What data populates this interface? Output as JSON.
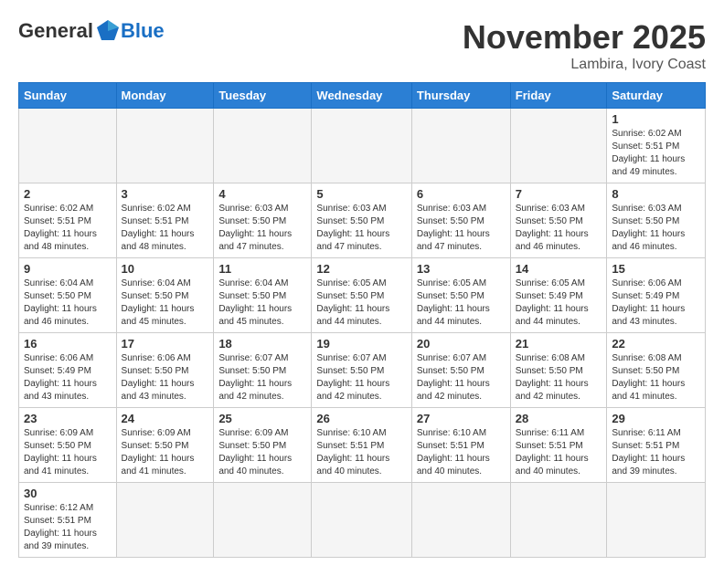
{
  "header": {
    "logo_general": "General",
    "logo_blue": "Blue",
    "month_title": "November 2025",
    "location": "Lambira, Ivory Coast"
  },
  "weekdays": [
    "Sunday",
    "Monday",
    "Tuesday",
    "Wednesday",
    "Thursday",
    "Friday",
    "Saturday"
  ],
  "weeks": [
    [
      {
        "day": "",
        "info": ""
      },
      {
        "day": "",
        "info": ""
      },
      {
        "day": "",
        "info": ""
      },
      {
        "day": "",
        "info": ""
      },
      {
        "day": "",
        "info": ""
      },
      {
        "day": "",
        "info": ""
      },
      {
        "day": "1",
        "info": "Sunrise: 6:02 AM\nSunset: 5:51 PM\nDaylight: 11 hours\nand 49 minutes."
      }
    ],
    [
      {
        "day": "2",
        "info": "Sunrise: 6:02 AM\nSunset: 5:51 PM\nDaylight: 11 hours\nand 48 minutes."
      },
      {
        "day": "3",
        "info": "Sunrise: 6:02 AM\nSunset: 5:51 PM\nDaylight: 11 hours\nand 48 minutes."
      },
      {
        "day": "4",
        "info": "Sunrise: 6:03 AM\nSunset: 5:50 PM\nDaylight: 11 hours\nand 47 minutes."
      },
      {
        "day": "5",
        "info": "Sunrise: 6:03 AM\nSunset: 5:50 PM\nDaylight: 11 hours\nand 47 minutes."
      },
      {
        "day": "6",
        "info": "Sunrise: 6:03 AM\nSunset: 5:50 PM\nDaylight: 11 hours\nand 47 minutes."
      },
      {
        "day": "7",
        "info": "Sunrise: 6:03 AM\nSunset: 5:50 PM\nDaylight: 11 hours\nand 46 minutes."
      },
      {
        "day": "8",
        "info": "Sunrise: 6:03 AM\nSunset: 5:50 PM\nDaylight: 11 hours\nand 46 minutes."
      }
    ],
    [
      {
        "day": "9",
        "info": "Sunrise: 6:04 AM\nSunset: 5:50 PM\nDaylight: 11 hours\nand 46 minutes."
      },
      {
        "day": "10",
        "info": "Sunrise: 6:04 AM\nSunset: 5:50 PM\nDaylight: 11 hours\nand 45 minutes."
      },
      {
        "day": "11",
        "info": "Sunrise: 6:04 AM\nSunset: 5:50 PM\nDaylight: 11 hours\nand 45 minutes."
      },
      {
        "day": "12",
        "info": "Sunrise: 6:05 AM\nSunset: 5:50 PM\nDaylight: 11 hours\nand 44 minutes."
      },
      {
        "day": "13",
        "info": "Sunrise: 6:05 AM\nSunset: 5:50 PM\nDaylight: 11 hours\nand 44 minutes."
      },
      {
        "day": "14",
        "info": "Sunrise: 6:05 AM\nSunset: 5:49 PM\nDaylight: 11 hours\nand 44 minutes."
      },
      {
        "day": "15",
        "info": "Sunrise: 6:06 AM\nSunset: 5:49 PM\nDaylight: 11 hours\nand 43 minutes."
      }
    ],
    [
      {
        "day": "16",
        "info": "Sunrise: 6:06 AM\nSunset: 5:49 PM\nDaylight: 11 hours\nand 43 minutes."
      },
      {
        "day": "17",
        "info": "Sunrise: 6:06 AM\nSunset: 5:50 PM\nDaylight: 11 hours\nand 43 minutes."
      },
      {
        "day": "18",
        "info": "Sunrise: 6:07 AM\nSunset: 5:50 PM\nDaylight: 11 hours\nand 42 minutes."
      },
      {
        "day": "19",
        "info": "Sunrise: 6:07 AM\nSunset: 5:50 PM\nDaylight: 11 hours\nand 42 minutes."
      },
      {
        "day": "20",
        "info": "Sunrise: 6:07 AM\nSunset: 5:50 PM\nDaylight: 11 hours\nand 42 minutes."
      },
      {
        "day": "21",
        "info": "Sunrise: 6:08 AM\nSunset: 5:50 PM\nDaylight: 11 hours\nand 42 minutes."
      },
      {
        "day": "22",
        "info": "Sunrise: 6:08 AM\nSunset: 5:50 PM\nDaylight: 11 hours\nand 41 minutes."
      }
    ],
    [
      {
        "day": "23",
        "info": "Sunrise: 6:09 AM\nSunset: 5:50 PM\nDaylight: 11 hours\nand 41 minutes."
      },
      {
        "day": "24",
        "info": "Sunrise: 6:09 AM\nSunset: 5:50 PM\nDaylight: 11 hours\nand 41 minutes."
      },
      {
        "day": "25",
        "info": "Sunrise: 6:09 AM\nSunset: 5:50 PM\nDaylight: 11 hours\nand 40 minutes."
      },
      {
        "day": "26",
        "info": "Sunrise: 6:10 AM\nSunset: 5:51 PM\nDaylight: 11 hours\nand 40 minutes."
      },
      {
        "day": "27",
        "info": "Sunrise: 6:10 AM\nSunset: 5:51 PM\nDaylight: 11 hours\nand 40 minutes."
      },
      {
        "day": "28",
        "info": "Sunrise: 6:11 AM\nSunset: 5:51 PM\nDaylight: 11 hours\nand 40 minutes."
      },
      {
        "day": "29",
        "info": "Sunrise: 6:11 AM\nSunset: 5:51 PM\nDaylight: 11 hours\nand 39 minutes."
      }
    ],
    [
      {
        "day": "30",
        "info": "Sunrise: 6:12 AM\nSunset: 5:51 PM\nDaylight: 11 hours\nand 39 minutes."
      },
      {
        "day": "",
        "info": ""
      },
      {
        "day": "",
        "info": ""
      },
      {
        "day": "",
        "info": ""
      },
      {
        "day": "",
        "info": ""
      },
      {
        "day": "",
        "info": ""
      },
      {
        "day": "",
        "info": ""
      }
    ]
  ]
}
